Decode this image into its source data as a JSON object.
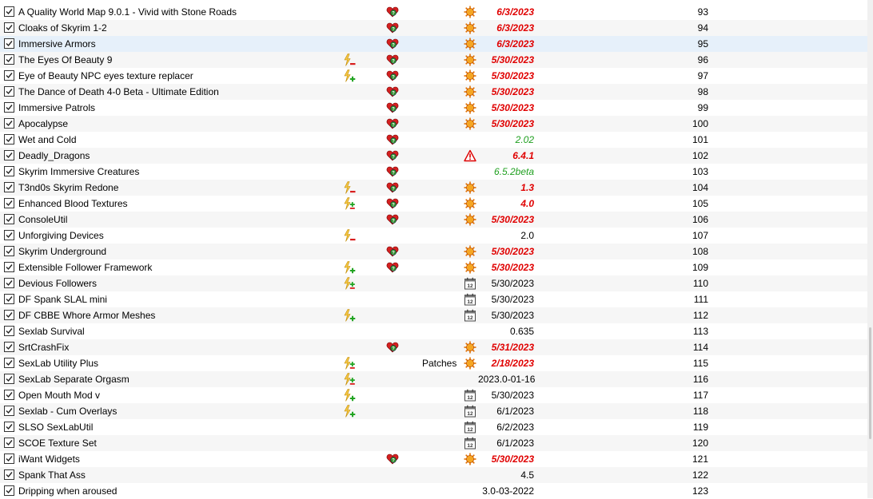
{
  "colors": {
    "selected_row": "#e6f0fa",
    "alt_row": "#f6f6f6",
    "outdated_version": "#e00000",
    "newer_version": "#20a020"
  },
  "rows": [
    {
      "name": "A Quality World Map 9.0.1 - Vivid with Stone Roads",
      "enabled": true,
      "flag_icons": [],
      "conflict_icon": "heart-icon",
      "category": "",
      "version_icon": "sun-icon",
      "version": "6/3/2023",
      "version_style": "red",
      "priority": "93"
    },
    {
      "name": "Cloaks of Skyrim 1-2",
      "enabled": true,
      "flag_icons": [],
      "conflict_icon": "heart-icon",
      "category": "",
      "version_icon": "sun-icon",
      "version": "6/3/2023",
      "version_style": "red",
      "priority": "94"
    },
    {
      "name": "Immersive Armors",
      "enabled": true,
      "selected": true,
      "flag_icons": [],
      "conflict_icon": "heart-icon",
      "category": "",
      "version_icon": "sun-icon",
      "version": "6/3/2023",
      "version_style": "red",
      "priority": "95"
    },
    {
      "name": "The Eyes Of Beauty 9",
      "enabled": true,
      "flag_icons": [
        "lightning-minus-icon"
      ],
      "conflict_icon": "heart-icon",
      "category": "",
      "version_icon": "sun-icon",
      "version": "5/30/2023",
      "version_style": "red",
      "priority": "96"
    },
    {
      "name": "Eye of Beauty NPC eyes texture replacer",
      "enabled": true,
      "flag_icons": [
        "lightning-plus-icon"
      ],
      "conflict_icon": "heart-icon",
      "category": "",
      "version_icon": "sun-icon",
      "version": "5/30/2023",
      "version_style": "red",
      "priority": "97"
    },
    {
      "name": "The Dance of Death 4-0 Beta - Ultimate Edition",
      "enabled": true,
      "flag_icons": [],
      "conflict_icon": "heart-icon",
      "category": "",
      "version_icon": "sun-icon",
      "version": "5/30/2023",
      "version_style": "red",
      "priority": "98"
    },
    {
      "name": "Immersive Patrols",
      "enabled": true,
      "flag_icons": [],
      "conflict_icon": "heart-icon",
      "category": "",
      "version_icon": "sun-icon",
      "version": "5/30/2023",
      "version_style": "red",
      "priority": "99"
    },
    {
      "name": "Apocalypse",
      "enabled": true,
      "flag_icons": [],
      "conflict_icon": "heart-icon",
      "category": "",
      "version_icon": "sun-icon",
      "version": "5/30/2023",
      "version_style": "red",
      "priority": "100"
    },
    {
      "name": "Wet and Cold",
      "enabled": true,
      "flag_icons": [],
      "conflict_icon": "heart-icon",
      "category": "",
      "version_icon": "",
      "version": "2.02",
      "version_style": "green",
      "priority": "101"
    },
    {
      "name": "Deadly_Dragons",
      "enabled": true,
      "flag_icons": [],
      "conflict_icon": "heart-icon",
      "category": "",
      "version_icon": "warning-icon",
      "version": "6.4.1",
      "version_style": "red",
      "priority": "102"
    },
    {
      "name": "Skyrim Immersive Creatures",
      "enabled": true,
      "flag_icons": [],
      "conflict_icon": "heart-icon",
      "category": "",
      "version_icon": "",
      "version": "6.5.2beta",
      "version_style": "green",
      "priority": "103"
    },
    {
      "name": "T3nd0s Skyrim Redone",
      "enabled": true,
      "flag_icons": [
        "lightning-minus-icon"
      ],
      "conflict_icon": "heart-icon",
      "category": "",
      "version_icon": "sun-icon",
      "version": "1.3",
      "version_style": "red",
      "priority": "104"
    },
    {
      "name": "Enhanced Blood Textures",
      "enabled": true,
      "flag_icons": [
        "lightning-plusminus-icon"
      ],
      "conflict_icon": "heart-icon",
      "category": "",
      "version_icon": "sun-icon",
      "version": "4.0",
      "version_style": "red",
      "priority": "105"
    },
    {
      "name": "ConsoleUtil",
      "enabled": true,
      "flag_icons": [],
      "conflict_icon": "heart-icon",
      "category": "",
      "version_icon": "sun-icon",
      "version": "5/30/2023",
      "version_style": "red",
      "priority": "106"
    },
    {
      "name": "Unforgiving Devices",
      "enabled": true,
      "flag_icons": [
        "lightning-minus-icon"
      ],
      "conflict_icon": "",
      "category": "",
      "version_icon": "",
      "version": "2.0",
      "version_style": "normal",
      "priority": "107"
    },
    {
      "name": "Skyrim Underground",
      "enabled": true,
      "flag_icons": [],
      "conflict_icon": "heart-icon",
      "category": "",
      "version_icon": "sun-icon",
      "version": "5/30/2023",
      "version_style": "red",
      "priority": "108"
    },
    {
      "name": "Extensible Follower Framework",
      "enabled": true,
      "flag_icons": [
        "lightning-plus-icon"
      ],
      "conflict_icon": "heart-icon",
      "category": "",
      "version_icon": "sun-icon",
      "version": "5/30/2023",
      "version_style": "red",
      "priority": "109"
    },
    {
      "name": "Devious Followers",
      "enabled": true,
      "flag_icons": [
        "lightning-plusminus-icon"
      ],
      "conflict_icon": "",
      "category": "",
      "version_icon": "calendar-icon",
      "version": "5/30/2023",
      "version_style": "normal",
      "priority": "110"
    },
    {
      "name": "DF Spank SLAL mini",
      "enabled": true,
      "flag_icons": [],
      "conflict_icon": "",
      "category": "",
      "version_icon": "calendar-icon",
      "version": "5/30/2023",
      "version_style": "normal",
      "priority": "111"
    },
    {
      "name": "DF CBBE Whore Armor Meshes",
      "enabled": true,
      "flag_icons": [
        "lightning-plus-icon"
      ],
      "conflict_icon": "",
      "category": "",
      "version_icon": "calendar-icon",
      "version": "5/30/2023",
      "version_style": "normal",
      "priority": "112"
    },
    {
      "name": "Sexlab Survival",
      "enabled": true,
      "flag_icons": [],
      "conflict_icon": "",
      "category": "",
      "version_icon": "",
      "version": "0.635",
      "version_style": "normal",
      "priority": "113"
    },
    {
      "name": "SrtCrashFix",
      "enabled": true,
      "flag_icons": [],
      "conflict_icon": "heart-icon",
      "category": "",
      "version_icon": "sun-icon",
      "version": "5/31/2023",
      "version_style": "red",
      "priority": "114"
    },
    {
      "name": "SexLab Utility Plus",
      "enabled": true,
      "flag_icons": [
        "lightning-plusminus-icon"
      ],
      "conflict_icon": "",
      "category": "Patches",
      "version_icon": "sun-icon",
      "version": "2/18/2023",
      "version_style": "red",
      "priority": "115"
    },
    {
      "name": "SexLab Separate Orgasm",
      "enabled": true,
      "flag_icons": [
        "lightning-plusminus-icon"
      ],
      "conflict_icon": "",
      "category": "",
      "version_icon": "",
      "version": "2023.0-01-16",
      "version_style": "normal",
      "priority": "116"
    },
    {
      "name": "Open Mouth Mod v",
      "enabled": true,
      "flag_icons": [
        "lightning-plus-icon"
      ],
      "conflict_icon": "",
      "category": "",
      "version_icon": "calendar-icon",
      "version": "5/30/2023",
      "version_style": "normal",
      "priority": "117"
    },
    {
      "name": "Sexlab - Cum Overlays",
      "enabled": true,
      "flag_icons": [
        "lightning-plus-icon"
      ],
      "conflict_icon": "",
      "category": "",
      "version_icon": "calendar-icon",
      "version": "6/1/2023",
      "version_style": "normal",
      "priority": "118"
    },
    {
      "name": "SLSO SexLabUtil",
      "enabled": true,
      "flag_icons": [],
      "conflict_icon": "",
      "category": "",
      "version_icon": "calendar-icon",
      "version": "6/2/2023",
      "version_style": "normal",
      "priority": "119"
    },
    {
      "name": "SCOE Texture Set",
      "enabled": true,
      "flag_icons": [],
      "conflict_icon": "",
      "category": "",
      "version_icon": "calendar-icon",
      "version": "6/1/2023",
      "version_style": "normal",
      "priority": "120"
    },
    {
      "name": "iWant Widgets",
      "enabled": true,
      "flag_icons": [],
      "conflict_icon": "heart-icon",
      "category": "",
      "version_icon": "sun-icon",
      "version": "5/30/2023",
      "version_style": "red",
      "priority": "121"
    },
    {
      "name": "Spank That Ass",
      "enabled": true,
      "flag_icons": [],
      "conflict_icon": "",
      "category": "",
      "version_icon": "",
      "version": "4.5",
      "version_style": "normal",
      "priority": "122"
    },
    {
      "name": "Dripping when aroused",
      "enabled": true,
      "flag_icons": [],
      "conflict_icon": "",
      "category": "",
      "version_icon": "",
      "version": "3.0-03-2022",
      "version_style": "normal",
      "priority": "123"
    }
  ]
}
